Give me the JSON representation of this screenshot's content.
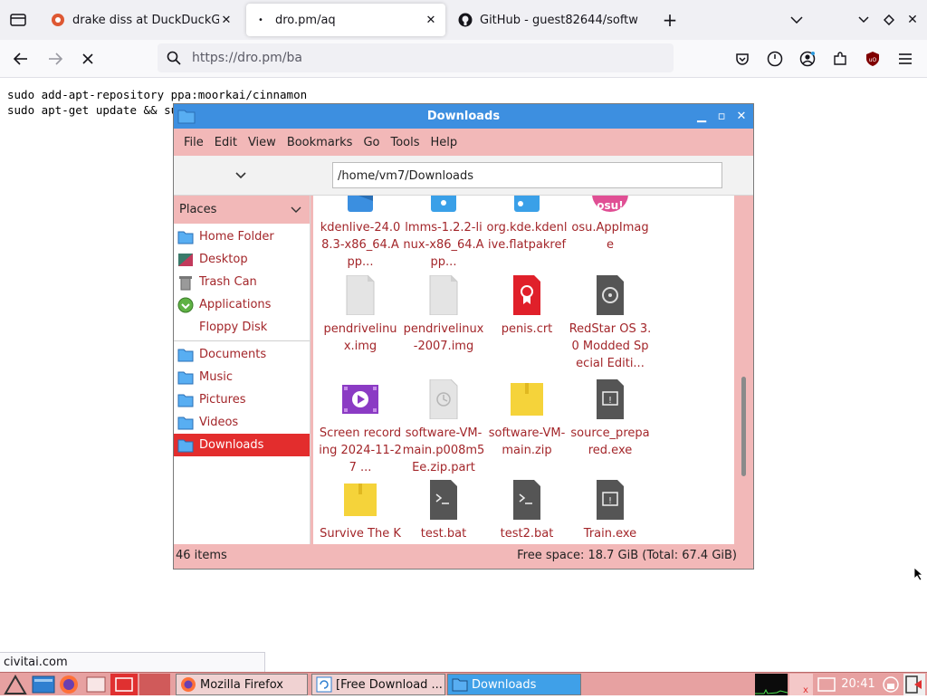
{
  "browser": {
    "tabs": [
      {
        "title": "drake diss at DuckDuckGo",
        "active": false,
        "icon": "duckduckgo-icon"
      },
      {
        "title": "dro.pm/aq",
        "active": true,
        "icon": "dot-icon"
      },
      {
        "title": "GitHub - guest82644/softw",
        "active": false,
        "icon": "github-icon"
      }
    ],
    "url": "https://dro.pm/ba",
    "status_url": "civitai.com"
  },
  "page": {
    "lines": [
      "sudo add-apt-repository ppa:moorkai/cinnamon",
      "sudo apt-get update && sud"
    ]
  },
  "file_manager": {
    "title": "Downloads",
    "menu": [
      "File",
      "Edit",
      "View",
      "Bookmarks",
      "Go",
      "Tools",
      "Help"
    ],
    "path": "/home/vm7/Downloads",
    "places_label": "Places",
    "places": [
      {
        "label": "Home Folder",
        "icon": "home-folder-icon"
      },
      {
        "label": "Desktop",
        "icon": "desktop-icon"
      },
      {
        "label": "Trash Can",
        "icon": "trash-icon"
      },
      {
        "label": "Applications",
        "icon": "applications-icon"
      },
      {
        "label": "Floppy Disk",
        "icon": "floppy-icon"
      }
    ],
    "bookmarks": [
      {
        "label": "Documents",
        "icon": "documents-folder-icon"
      },
      {
        "label": "Music",
        "icon": "music-folder-icon"
      },
      {
        "label": "Pictures",
        "icon": "pictures-folder-icon"
      },
      {
        "label": "Videos",
        "icon": "videos-folder-icon"
      },
      {
        "label": "Downloads",
        "icon": "downloads-folder-icon",
        "selected": true
      }
    ],
    "files": [
      {
        "name": "kdenlive-24.08.3-x86_64.App...",
        "icon": "appimage-icon"
      },
      {
        "name": "lmms-1.2.2-linux-x86_64.App...",
        "icon": "appimage-icon"
      },
      {
        "name": "org.kde.kdenlive.flatpakref",
        "icon": "flatpak-icon"
      },
      {
        "name": "osu.AppImage",
        "icon": "osu-icon"
      },
      {
        "name": "pendrivelinux.img",
        "icon": "file-icon"
      },
      {
        "name": "pendrivelinux-2007.img",
        "icon": "file-icon"
      },
      {
        "name": "penis.crt",
        "icon": "certificate-icon"
      },
      {
        "name": "RedStar OS 3.0 Modded Special Editi...",
        "icon": "disc-image-icon"
      },
      {
        "name": "Screen recording 2024-11-27 ...",
        "icon": "video-file-icon"
      },
      {
        "name": "software-VM-main.p008m5Ee.zip.part",
        "icon": "partial-file-icon"
      },
      {
        "name": "software-VM-main.zip",
        "icon": "zip-icon"
      },
      {
        "name": "source_prepared.exe",
        "icon": "exe-icon"
      },
      {
        "name": "Survive The KSI Song.zip",
        "icon": "zip-icon"
      },
      {
        "name": "test.bat",
        "icon": "script-icon"
      },
      {
        "name": "test2.bat",
        "icon": "script-icon"
      },
      {
        "name": "Train.exe",
        "icon": "exe-icon"
      }
    ],
    "item_count": "46 items",
    "free_space": "Free space: 18.7 GiB (Total: 67.4 GiB)"
  },
  "taskbar": {
    "tasks": [
      {
        "label": "Mozilla Firefox",
        "icon": "firefox-icon",
        "active": false
      },
      {
        "label": "[Free Download ...",
        "icon": "download-icon",
        "active": false
      },
      {
        "label": "Downloads",
        "icon": "folder-icon",
        "active": true
      }
    ],
    "clock": "20:41"
  },
  "colors": {
    "accent": "#3d8fe0",
    "selection": "#e32d2d",
    "file_text": "#a3262a",
    "pane_bg": "#f2b8b8"
  }
}
